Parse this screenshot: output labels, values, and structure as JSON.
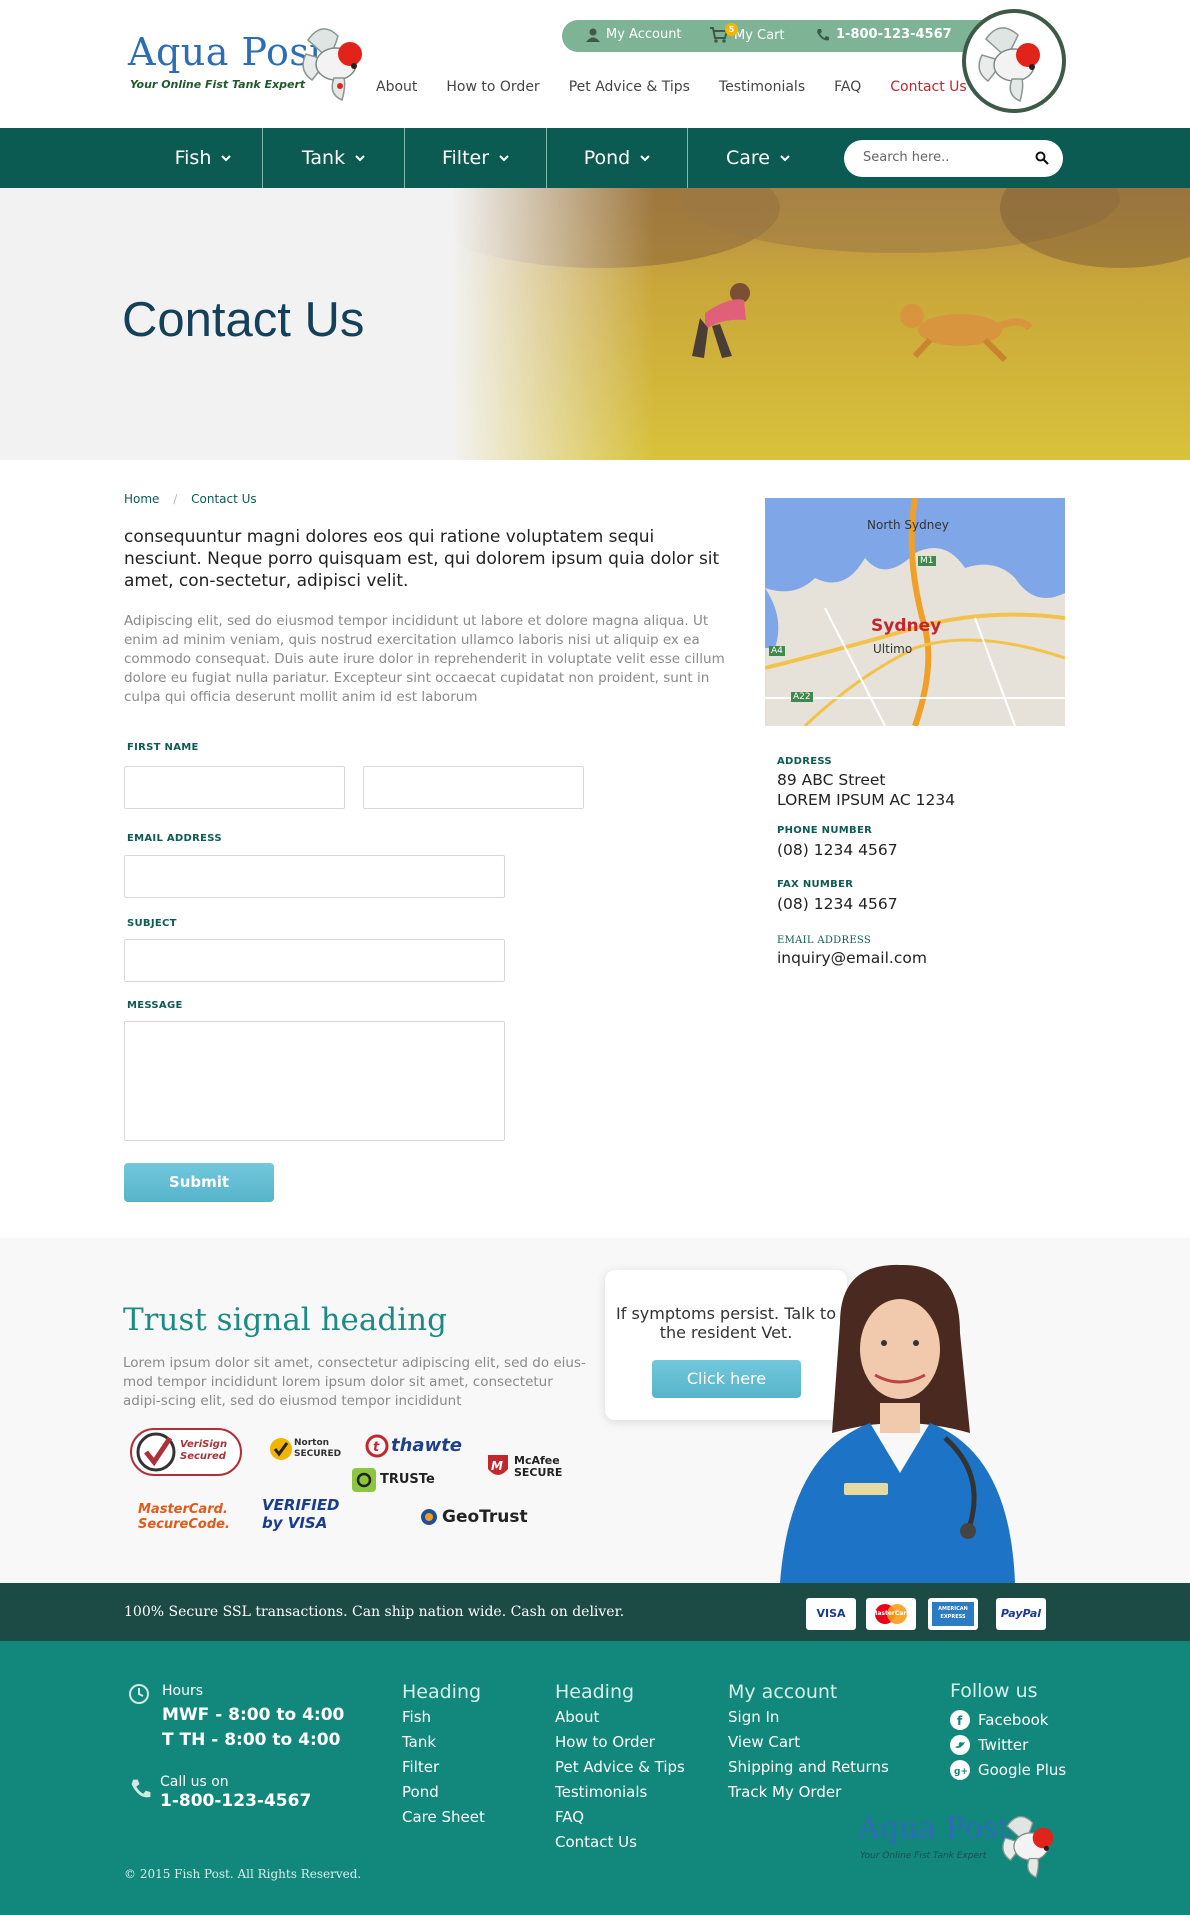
{
  "header": {
    "logo_text": "Aqua Post",
    "logo_tagline": "Your Online Fist Tank Expert",
    "topbar": {
      "account": "My Account",
      "cart": "My Cart",
      "cart_count": "5",
      "phone": "1-800-123-4567"
    },
    "nav": [
      "About",
      "How to Order",
      "Pet Advice & Tips",
      "Testimonials",
      "FAQ",
      "Contact Us"
    ],
    "active_nav": "Contact Us"
  },
  "categories": [
    "Fish",
    "Tank",
    "Filter",
    "Pond",
    "Care"
  ],
  "search": {
    "placeholder": "Search here.."
  },
  "hero": {
    "title": "Contact Us"
  },
  "breadcrumb": {
    "home": "Home",
    "current": "Contact Us"
  },
  "content": {
    "lead": "consequuntur magni dolores eos qui ratione voluptatem sequi nesciunt. Neque porro quisquam est, qui dolorem ipsum quia dolor sit amet, con-sectetur, adipisci velit.",
    "paragraph": "Adipiscing elit, sed do eiusmod tempor incididunt ut labore et dolore magna aliqua. Ut enim ad minim veniam, quis nostrud exercitation ullamco laboris nisi ut aliquip ex ea commodo consequat. Duis aute irure dolor in reprehenderit in voluptate velit esse cillum dolore eu fugiat nulla pariatur. Excepteur sint occaecat cupidatat non proident, sunt in culpa qui officia deserunt mollit anim id est laborum"
  },
  "form": {
    "first_name_label": "FIRST NAME",
    "email_label": "EMAIL ADDRESS",
    "subject_label": "SUBJECT",
    "message_label": "MESSAGE",
    "submit": "Submit"
  },
  "map": {
    "north_sydney": "North Sydney",
    "sydney": "Sydney",
    "ultimo": "Ultimo",
    "m1": "M1",
    "a4": "A4",
    "a22": "A22"
  },
  "contact": {
    "address_label": "ADDRESS",
    "address_line1": "89 ABC Street",
    "address_line2": "LOREM IPSUM AC 1234",
    "phone_label": "PHONE NUMBER",
    "phone": "(08) 1234 4567",
    "fax_label": "FAX NUMBER",
    "fax": "(08) 1234 4567",
    "email_label": "EMAIL ADDRESS",
    "email": "inquiry@email.com"
  },
  "trust": {
    "heading": "Trust signal heading",
    "text": "Lorem ipsum dolor sit amet, consectetur adipiscing elit, sed do eius-mod tempor incididunt lorem ipsum dolor sit amet, consectetur adipi-scing elit, sed do eiusmod tempor incididunt",
    "seals": [
      "VeriSign Secured",
      "Norton SECURED",
      "thawte",
      "McAfee SECURE",
      "TRUSTe",
      "MasterCard. SecureCode.",
      "VERIFIED by VISA",
      "GeoTrust"
    ],
    "vet_text": "If symptoms persist. Talk to the resident Vet.",
    "vet_button": "Click here"
  },
  "strip": {
    "text": "100% Secure SSL transactions. Can ship nation wide. Cash on deliver.",
    "cards": [
      "VISA",
      "MasterCard",
      "AMERICAN EXPRESS",
      "PayPal"
    ]
  },
  "footer": {
    "hours_label": "Hours",
    "hours_1": "MWF - 8:00 to 4:00",
    "hours_2": "T TH - 8:00 to 4:00",
    "call_label": "Call us on",
    "call_number": "1-800-123-4567",
    "col1": {
      "heading": "Heading",
      "links": [
        "Fish",
        "Tank",
        "Filter",
        "Pond",
        "Care Sheet"
      ]
    },
    "col2": {
      "heading": "Heading",
      "links": [
        "About",
        "How to Order",
        "Pet Advice & Tips",
        "Testimonials",
        "FAQ",
        "Contact Us"
      ]
    },
    "col3": {
      "heading": "My account",
      "links": [
        "Sign In",
        "View Cart",
        "Shipping and Returns",
        "Track My Order"
      ]
    },
    "col4": {
      "heading": "Follow us",
      "links": [
        "Facebook",
        "Twitter",
        "Google Plus"
      ]
    },
    "copyright": "© 2015 Fish Post. All Rights Reserved.",
    "logo_text": "Aqua Post",
    "logo_tagline": "Your Online Fist Tank Expert"
  },
  "colors": {
    "primary": "#0c5b52",
    "footer": "#12877c",
    "accent_red": "#c1272d",
    "button": "#5fbcd2"
  }
}
